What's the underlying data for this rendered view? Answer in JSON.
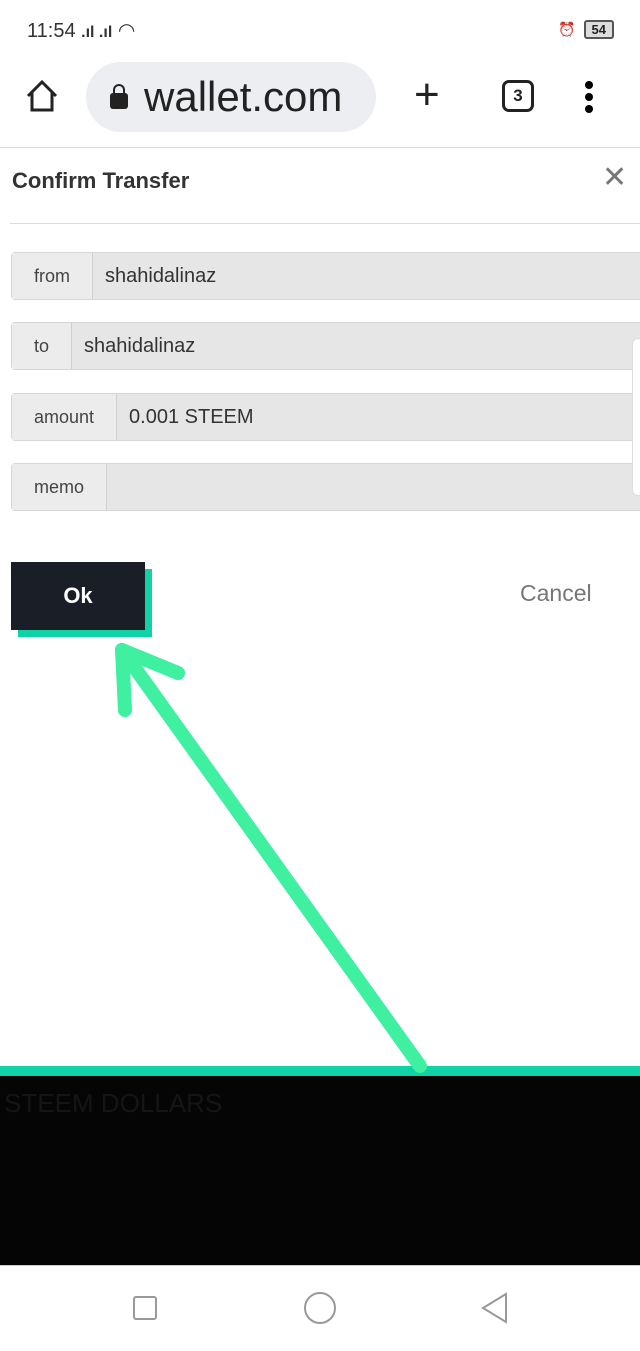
{
  "status_bar": {
    "time": "11:54",
    "signal": ".ıl .ıl",
    "battery": "54"
  },
  "browser": {
    "url": "wallet.com",
    "tab_count": "3"
  },
  "dialog": {
    "title": "Confirm Transfer",
    "fields": [
      {
        "label": "from",
        "value": "shahidalinaz"
      },
      {
        "label": "to",
        "value": "shahidalinaz"
      },
      {
        "label": "amount",
        "value": "0.001 STEEM"
      },
      {
        "label": "memo",
        "value": ""
      }
    ],
    "ok_label": "Ok",
    "cancel_label": "Cancel"
  },
  "background": {
    "heading": "STEEM DOLLARS"
  },
  "colors": {
    "accent": "#0fd3a6",
    "arrow": "#3ef0a0",
    "button": "#1a1f27"
  }
}
